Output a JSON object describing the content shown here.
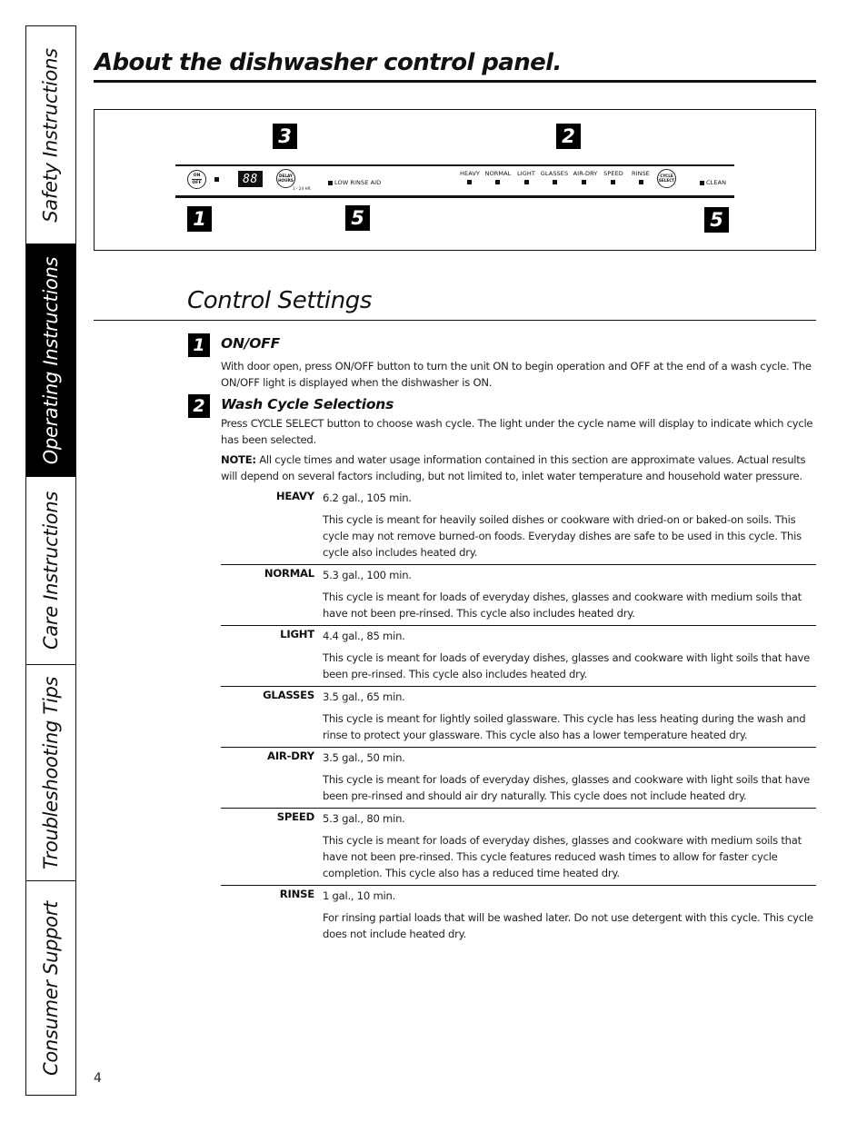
{
  "side_tabs": [
    {
      "label": "Safety Instructions",
      "active": false
    },
    {
      "label": "Operating Instructions",
      "active": true
    },
    {
      "label": "Care Instructions",
      "active": false
    },
    {
      "label": "Troubleshooting Tips",
      "active": false
    },
    {
      "label": "Consumer Support",
      "active": false
    }
  ],
  "header": {
    "title": "About the dishwasher control panel."
  },
  "panel": {
    "callouts": {
      "on_off": "1",
      "cycle": "2",
      "delay": "3",
      "rinse_aid": "5",
      "clean": "5"
    },
    "on_off_button": {
      "top": "ON",
      "bottom": "OFF"
    },
    "display": "88",
    "delay_button": {
      "top": "DELAY",
      "bottom": "HOURS"
    },
    "delay_range": "1 - 24 HR.",
    "low_rinse_aid": "LOW RINSE AID",
    "cycle_labels": [
      "HEAVY",
      "NORMAL",
      "LIGHT",
      "GLASSES",
      "AIR-DRY",
      "SPEED",
      "RINSE"
    ],
    "cycle_select_button": {
      "top": "CYCLE",
      "bottom": "SELECT"
    },
    "clean": "CLEAN"
  },
  "control_settings": {
    "title": "Control Settings",
    "items": [
      {
        "number": "1",
        "heading": "ON/OFF",
        "text": "With door open, press ON/OFF button to turn the unit ON to begin operation and OFF at the end of a wash cycle. The ON/OFF light is displayed when the dishwasher is ON."
      },
      {
        "number": "2",
        "heading": "Wash Cycle Selections",
        "text": "Press CYCLE SELECT button to choose wash cycle. The light under the cycle name will display to indicate which cycle has been selected.",
        "note_label": "NOTE:",
        "note_text": " All cycle times and water usage information contained in this section are approximate values. Actual results will depend on several factors including, but not limited to, inlet water temperature and household water pressure."
      }
    ],
    "cycles": [
      {
        "name": "HEAVY",
        "usage": "6.2 gal., 105 min.",
        "description": "This cycle is meant for heavily soiled dishes or cookware with dried-on or baked-on soils. This cycle may not remove burned-on foods. Everyday dishes are safe to be used in this cycle. This cycle also includes heated dry."
      },
      {
        "name": "NORMAL",
        "usage": "5.3 gal., 100 min.",
        "description": "This cycle is meant for loads of everyday dishes, glasses and cookware with medium soils that have not been pre-rinsed. This cycle also includes heated dry."
      },
      {
        "name": "LIGHT",
        "usage": "4.4 gal., 85 min.",
        "description": "This cycle is meant for loads of everyday dishes, glasses and cookware with light soils that have been pre-rinsed. This cycle also includes heated dry."
      },
      {
        "name": "GLASSES",
        "usage": "3.5 gal., 65 min.",
        "description": "This cycle is meant for lightly soiled glassware. This cycle has less heating during the wash and rinse to protect your glassware. This cycle also has a lower temperature heated dry."
      },
      {
        "name": "AIR-DRY",
        "usage": "3.5 gal., 50 min.",
        "description": "This cycle is meant for loads of everyday dishes, glasses and cookware with light soils that have been pre-rinsed and should air dry naturally. This cycle does not include heated dry."
      },
      {
        "name": "SPEED",
        "usage": "5.3 gal., 80 min.",
        "description": "This cycle is meant for loads of everyday dishes, glasses and cookware with medium soils that have not been pre-rinsed. This cycle features reduced wash times to allow for faster cycle completion. This cycle also has a reduced time heated dry."
      },
      {
        "name": "RINSE",
        "usage": "1 gal., 10 min.",
        "description": "For rinsing partial loads that will be washed later. Do not use detergent with this cycle. This cycle does not include heated dry."
      }
    ]
  },
  "footer": {
    "page_number": "4"
  }
}
